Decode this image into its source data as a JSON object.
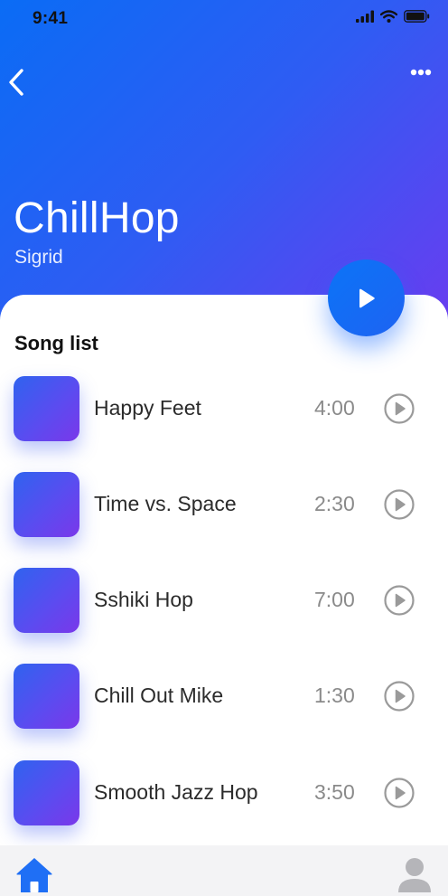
{
  "status_bar": {
    "time": "9:41",
    "icons": [
      "signal-icon",
      "wifi-icon",
      "battery-icon"
    ]
  },
  "header": {
    "back_icon": "chevron-left-icon",
    "more_icon": "more-horizontal-icon",
    "album_title": "ChillHop",
    "artist": "Sigrid",
    "play_icon": "play-icon"
  },
  "song_list": {
    "title": "Song list",
    "items": [
      {
        "title": "Happy Feet",
        "duration": "4:00"
      },
      {
        "title": "Time vs. Space",
        "duration": "2:30"
      },
      {
        "title": "Sshiki Hop",
        "duration": "7:00"
      },
      {
        "title": "Chill Out Mike",
        "duration": "1:30"
      },
      {
        "title": "Smooth Jazz Hop",
        "duration": "3:50"
      }
    ]
  },
  "tab_bar": {
    "items": [
      "home-icon",
      "profile-icon"
    ]
  },
  "colors": {
    "accent_blue": "#0a6cf5",
    "accent_purple": "#6a3cf0",
    "text_dark": "#2b2b2b",
    "text_muted": "#8a8a8a"
  }
}
